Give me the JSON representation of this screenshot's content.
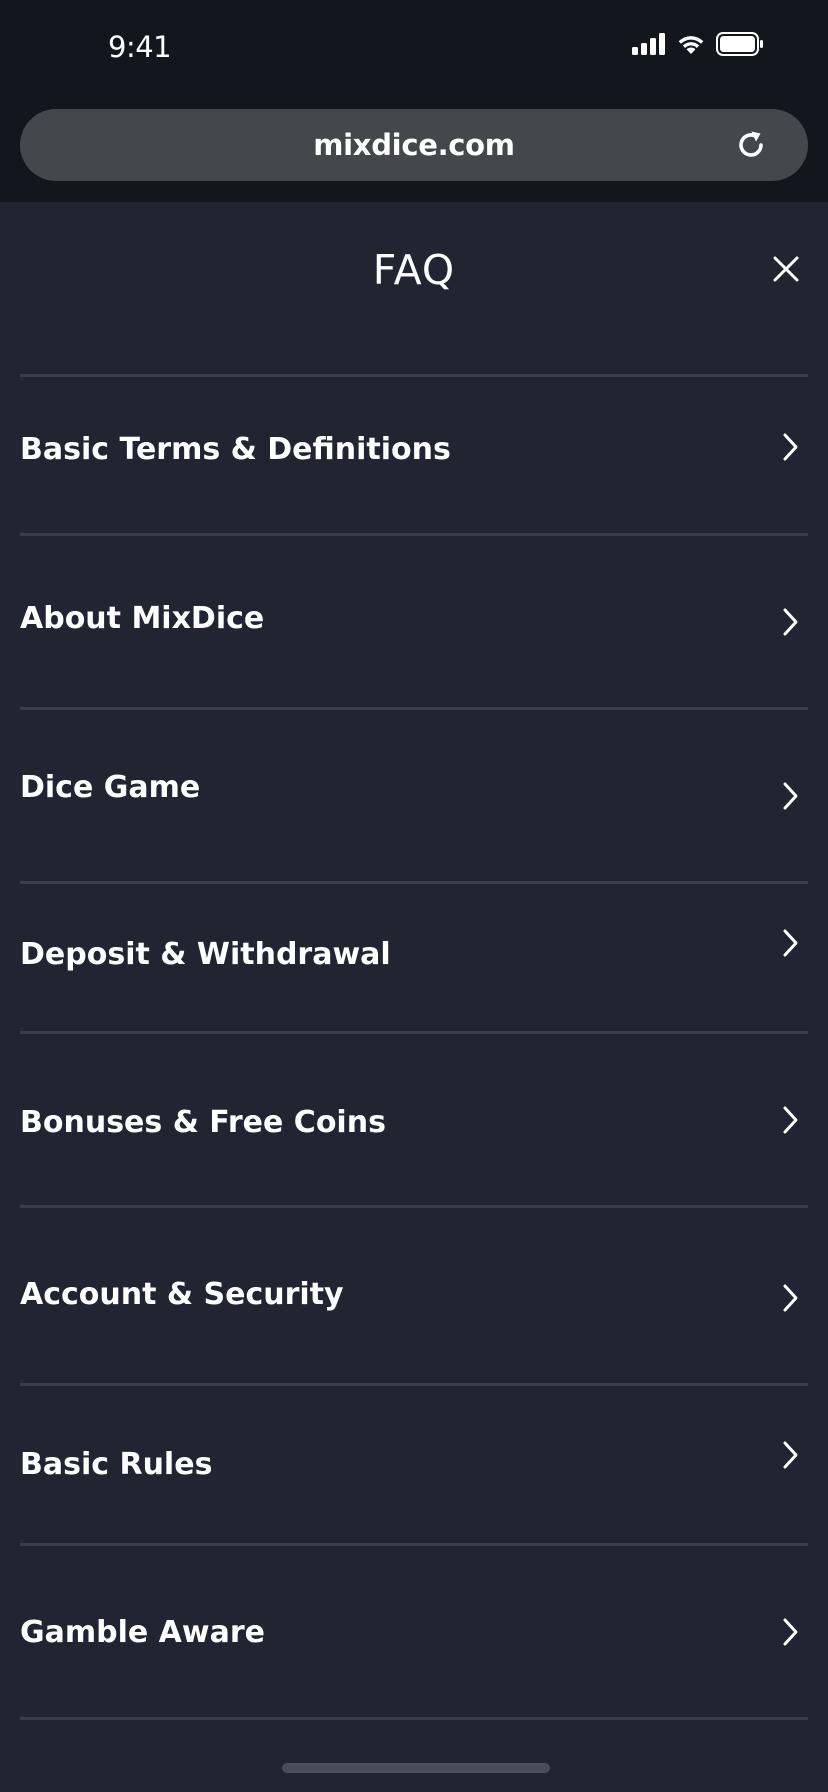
{
  "status_bar": {
    "time": "9:41",
    "icons": [
      "cellular-signal-icon",
      "wifi-icon",
      "battery-icon"
    ]
  },
  "browser": {
    "url": "mixdice.com",
    "reload_icon": "reload-icon"
  },
  "faq": {
    "title": "FAQ",
    "close_icon": "close-icon",
    "items": [
      {
        "label": "Basic Terms & Definitions"
      },
      {
        "label": "About MixDice"
      },
      {
        "label": "Dice Game"
      },
      {
        "label": "Deposit & Withdrawal"
      },
      {
        "label": "Bonuses & Free Coins"
      },
      {
        "label": "Account & Security"
      },
      {
        "label": "Basic Rules"
      },
      {
        "label": "Gamble Aware"
      }
    ],
    "chevron_icon": "chevron-right-icon"
  },
  "colors": {
    "chrome_background": "#14161d",
    "page_background": "#222431",
    "url_bar": "#45474d",
    "divider": "#3a3e4c",
    "text": "#ffffff"
  }
}
